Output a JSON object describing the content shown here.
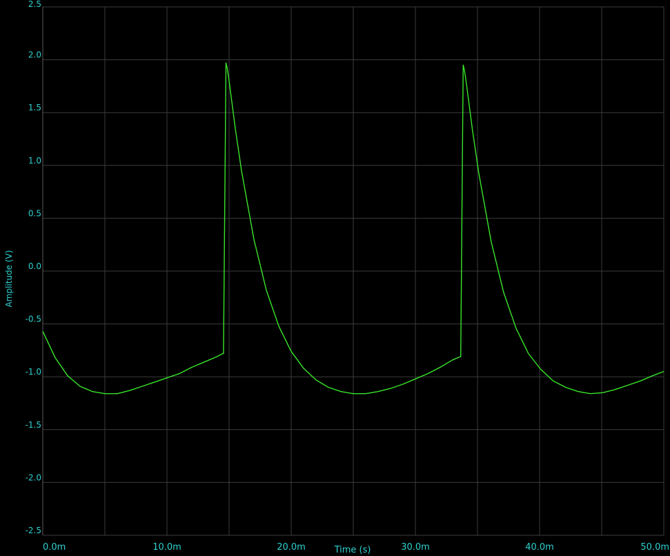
{
  "chart_data": {
    "type": "line",
    "title": "",
    "xlabel": "Time (s)",
    "ylabel": "Amplitude (V)",
    "xlim": [
      0,
      50
    ],
    "x_unit": "ms",
    "ylim": [
      -2.5,
      2.5
    ],
    "x_ticks": [
      0,
      10,
      20,
      30,
      40,
      50
    ],
    "x_tick_labels": [
      "0.0m",
      "10.0m",
      "20.0m",
      "30.0m",
      "40.0m",
      "50.0m"
    ],
    "y_ticks": [
      2.5,
      2.0,
      1.5,
      1.0,
      0.5,
      0.0,
      -0.5,
      -1.0,
      -1.5,
      -2.0,
      -2.5
    ],
    "y_tick_labels": [
      "2.5",
      "2.0",
      "1.5",
      "1.0",
      "0.5",
      "0.0",
      "-0.5",
      "-1.0",
      "-1.5",
      "-2.0",
      "-2.5"
    ],
    "grid": true,
    "colors": {
      "background": "#000000",
      "grid": "#3c3c3c",
      "axis_text": "#2ed1d1",
      "trace": "#39e62a"
    },
    "series": [
      {
        "x": [
          0.0,
          1.0,
          2.0,
          3.0,
          4.0,
          5.0,
          6.0,
          7.0,
          8.0,
          9.0,
          10.0,
          11.0,
          12.0,
          13.0,
          14.0,
          14.5,
          14.55,
          14.75,
          14.85,
          15.0,
          15.5,
          16.0,
          17.0,
          18.0,
          19.0,
          20.0,
          21.0,
          22.0,
          23.0,
          24.0,
          25.0,
          26.0,
          27.0,
          28.0,
          29.0,
          30.0,
          31.0,
          32.0,
          33.0,
          33.6,
          33.65,
          33.85,
          33.95,
          34.1,
          34.6,
          35.1,
          36.1,
          37.1,
          38.1,
          39.1,
          40.1,
          41.1,
          42.1,
          43.1,
          44.1,
          45.1,
          46.1,
          47.1,
          48.1,
          49.1,
          50.0
        ],
        "y": [
          -0.57,
          -0.82,
          -0.99,
          -1.09,
          -1.14,
          -1.16,
          -1.16,
          -1.13,
          -1.09,
          -1.05,
          -1.01,
          -0.97,
          -0.91,
          -0.86,
          -0.81,
          -0.78,
          -0.78,
          1.97,
          1.92,
          1.8,
          1.35,
          0.95,
          0.3,
          -0.18,
          -0.52,
          -0.76,
          -0.92,
          -1.03,
          -1.1,
          -1.14,
          -1.16,
          -1.16,
          -1.14,
          -1.11,
          -1.07,
          -1.02,
          -0.97,
          -0.91,
          -0.84,
          -0.81,
          -0.81,
          1.95,
          1.9,
          1.78,
          1.33,
          0.93,
          0.28,
          -0.2,
          -0.54,
          -0.78,
          -0.93,
          -1.04,
          -1.1,
          -1.14,
          -1.16,
          -1.15,
          -1.12,
          -1.08,
          -1.04,
          -0.99,
          -0.95
        ]
      }
    ]
  }
}
